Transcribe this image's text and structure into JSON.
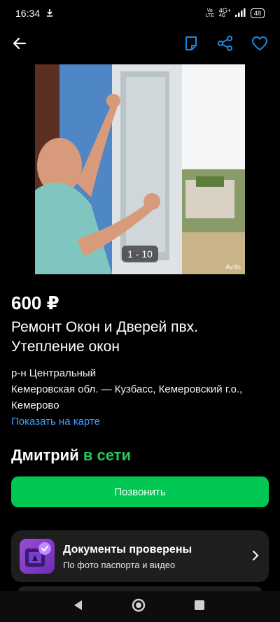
{
  "status_bar": {
    "time": "16:34",
    "network_top": "4G+",
    "network_bottom": "4G",
    "volte": "Vo LTE",
    "battery": "48"
  },
  "icons": {
    "back": "arrow-left-icon",
    "note": "note-icon",
    "share": "share-icon",
    "favorite": "heart-icon"
  },
  "listing": {
    "photo_counter": "1 - 10",
    "watermark": "Avito",
    "price": "600 ₽",
    "title": "Ремонт Окон и Дверей пвх. Утепление окон",
    "district": "р-н Центральный",
    "address_line1": "Кемеровская обл. — Кузбасс, Кемеровский г.о.,",
    "address_line2": "Кемерово",
    "map_link": "Показать на карте"
  },
  "seller": {
    "name": "Дмитрий",
    "status": "в сети"
  },
  "call_button": "Позвонить",
  "docs_card": {
    "title": "Документы проверены",
    "subtitle": "По фото паспорта и видео"
  },
  "colors": {
    "accent_green": "#00c853",
    "link_blue": "#3ea2ff",
    "online_green": "#25c95b",
    "icon_blue": "#1e88e5"
  }
}
